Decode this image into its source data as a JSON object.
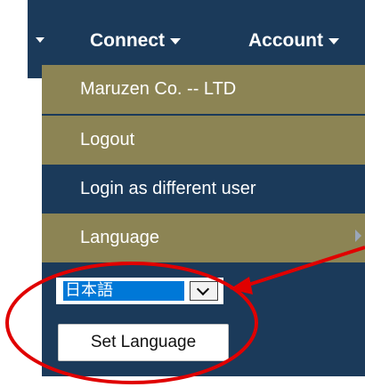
{
  "navbar": {
    "connect_label": "Connect",
    "account_label": "Account"
  },
  "dropdown": {
    "items": [
      {
        "label": "Maruzen Co. -- LTD"
      },
      {
        "label": "Logout"
      },
      {
        "label": "Login as different user"
      },
      {
        "label": "Language"
      }
    ]
  },
  "language": {
    "selected": "日本語",
    "set_button": "Set Language"
  },
  "colors": {
    "navbar_bg": "#1b3a5a",
    "menu_item_bg": "#8c8454",
    "highlight_blue": "#0078d7",
    "annotation_red": "#e00000"
  },
  "icons": {
    "nav_left_caret": "caret-down",
    "connect_caret": "caret-down",
    "account_caret": "caret-down",
    "language_submenu": "caret-right",
    "select_chevron": "chevron-down"
  }
}
